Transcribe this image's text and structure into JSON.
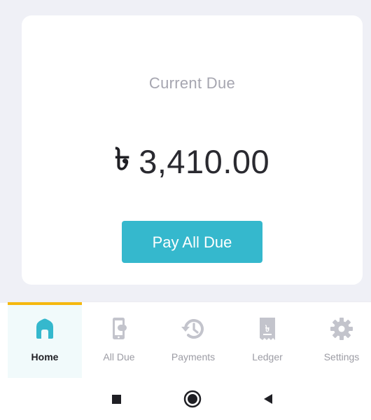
{
  "card": {
    "title": "Current Due",
    "currency_symbol": "৳",
    "amount": "3,410.00",
    "pay_button_label": "Pay All Due"
  },
  "nav": {
    "items": [
      {
        "label": "Home",
        "icon": "home-icon",
        "active": true
      },
      {
        "label": "All Due",
        "icon": "phone-due-icon",
        "active": false
      },
      {
        "label": "Payments",
        "icon": "history-icon",
        "active": false
      },
      {
        "label": "Ledger",
        "icon": "ledger-receipt-icon",
        "active": false
      },
      {
        "label": "Settings",
        "icon": "gear-icon",
        "active": false
      }
    ]
  },
  "system_nav": {
    "buttons": [
      "recent-apps-icon",
      "home-circle-icon",
      "back-icon"
    ]
  },
  "colors": {
    "accent": "#35b8cd",
    "active_indicator": "#f5b80e",
    "background": "#eff0f6",
    "inactive_icon": "#c3c4cc",
    "inactive_label": "#9c9ca4"
  }
}
